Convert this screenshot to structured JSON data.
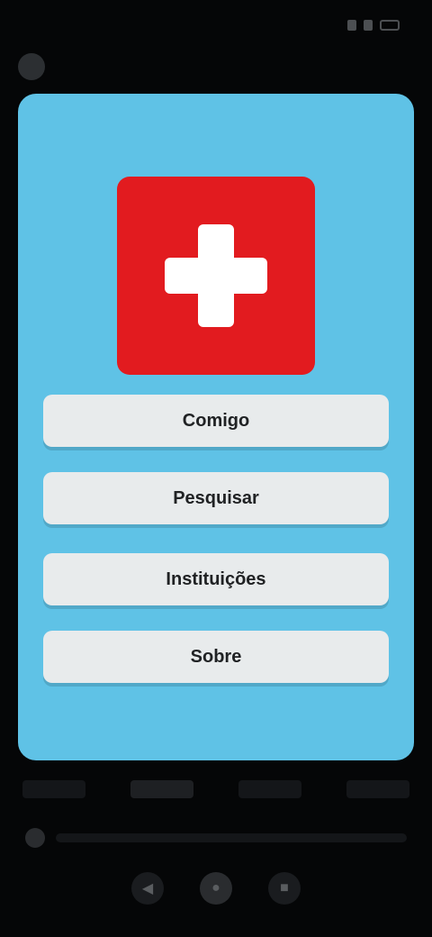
{
  "status": {
    "time": ""
  },
  "card": {
    "top_left": "",
    "top_center": ""
  },
  "hero": {
    "icon": "first-aid-cross-icon",
    "bg_color": "#e21b1f",
    "cross_color": "#ffffff"
  },
  "menu": {
    "buttons": [
      {
        "label": "Comigo"
      },
      {
        "label": "Pesquisar"
      },
      {
        "label": "Instituições"
      },
      {
        "label": "Sobre"
      }
    ]
  },
  "colors": {
    "card_bg": "#5fc2e6",
    "button_bg": "#e8ebec",
    "page_bg": "#050607"
  },
  "nav": {
    "back_glyph": "◀",
    "home_glyph": "●",
    "recents_glyph": "■"
  }
}
